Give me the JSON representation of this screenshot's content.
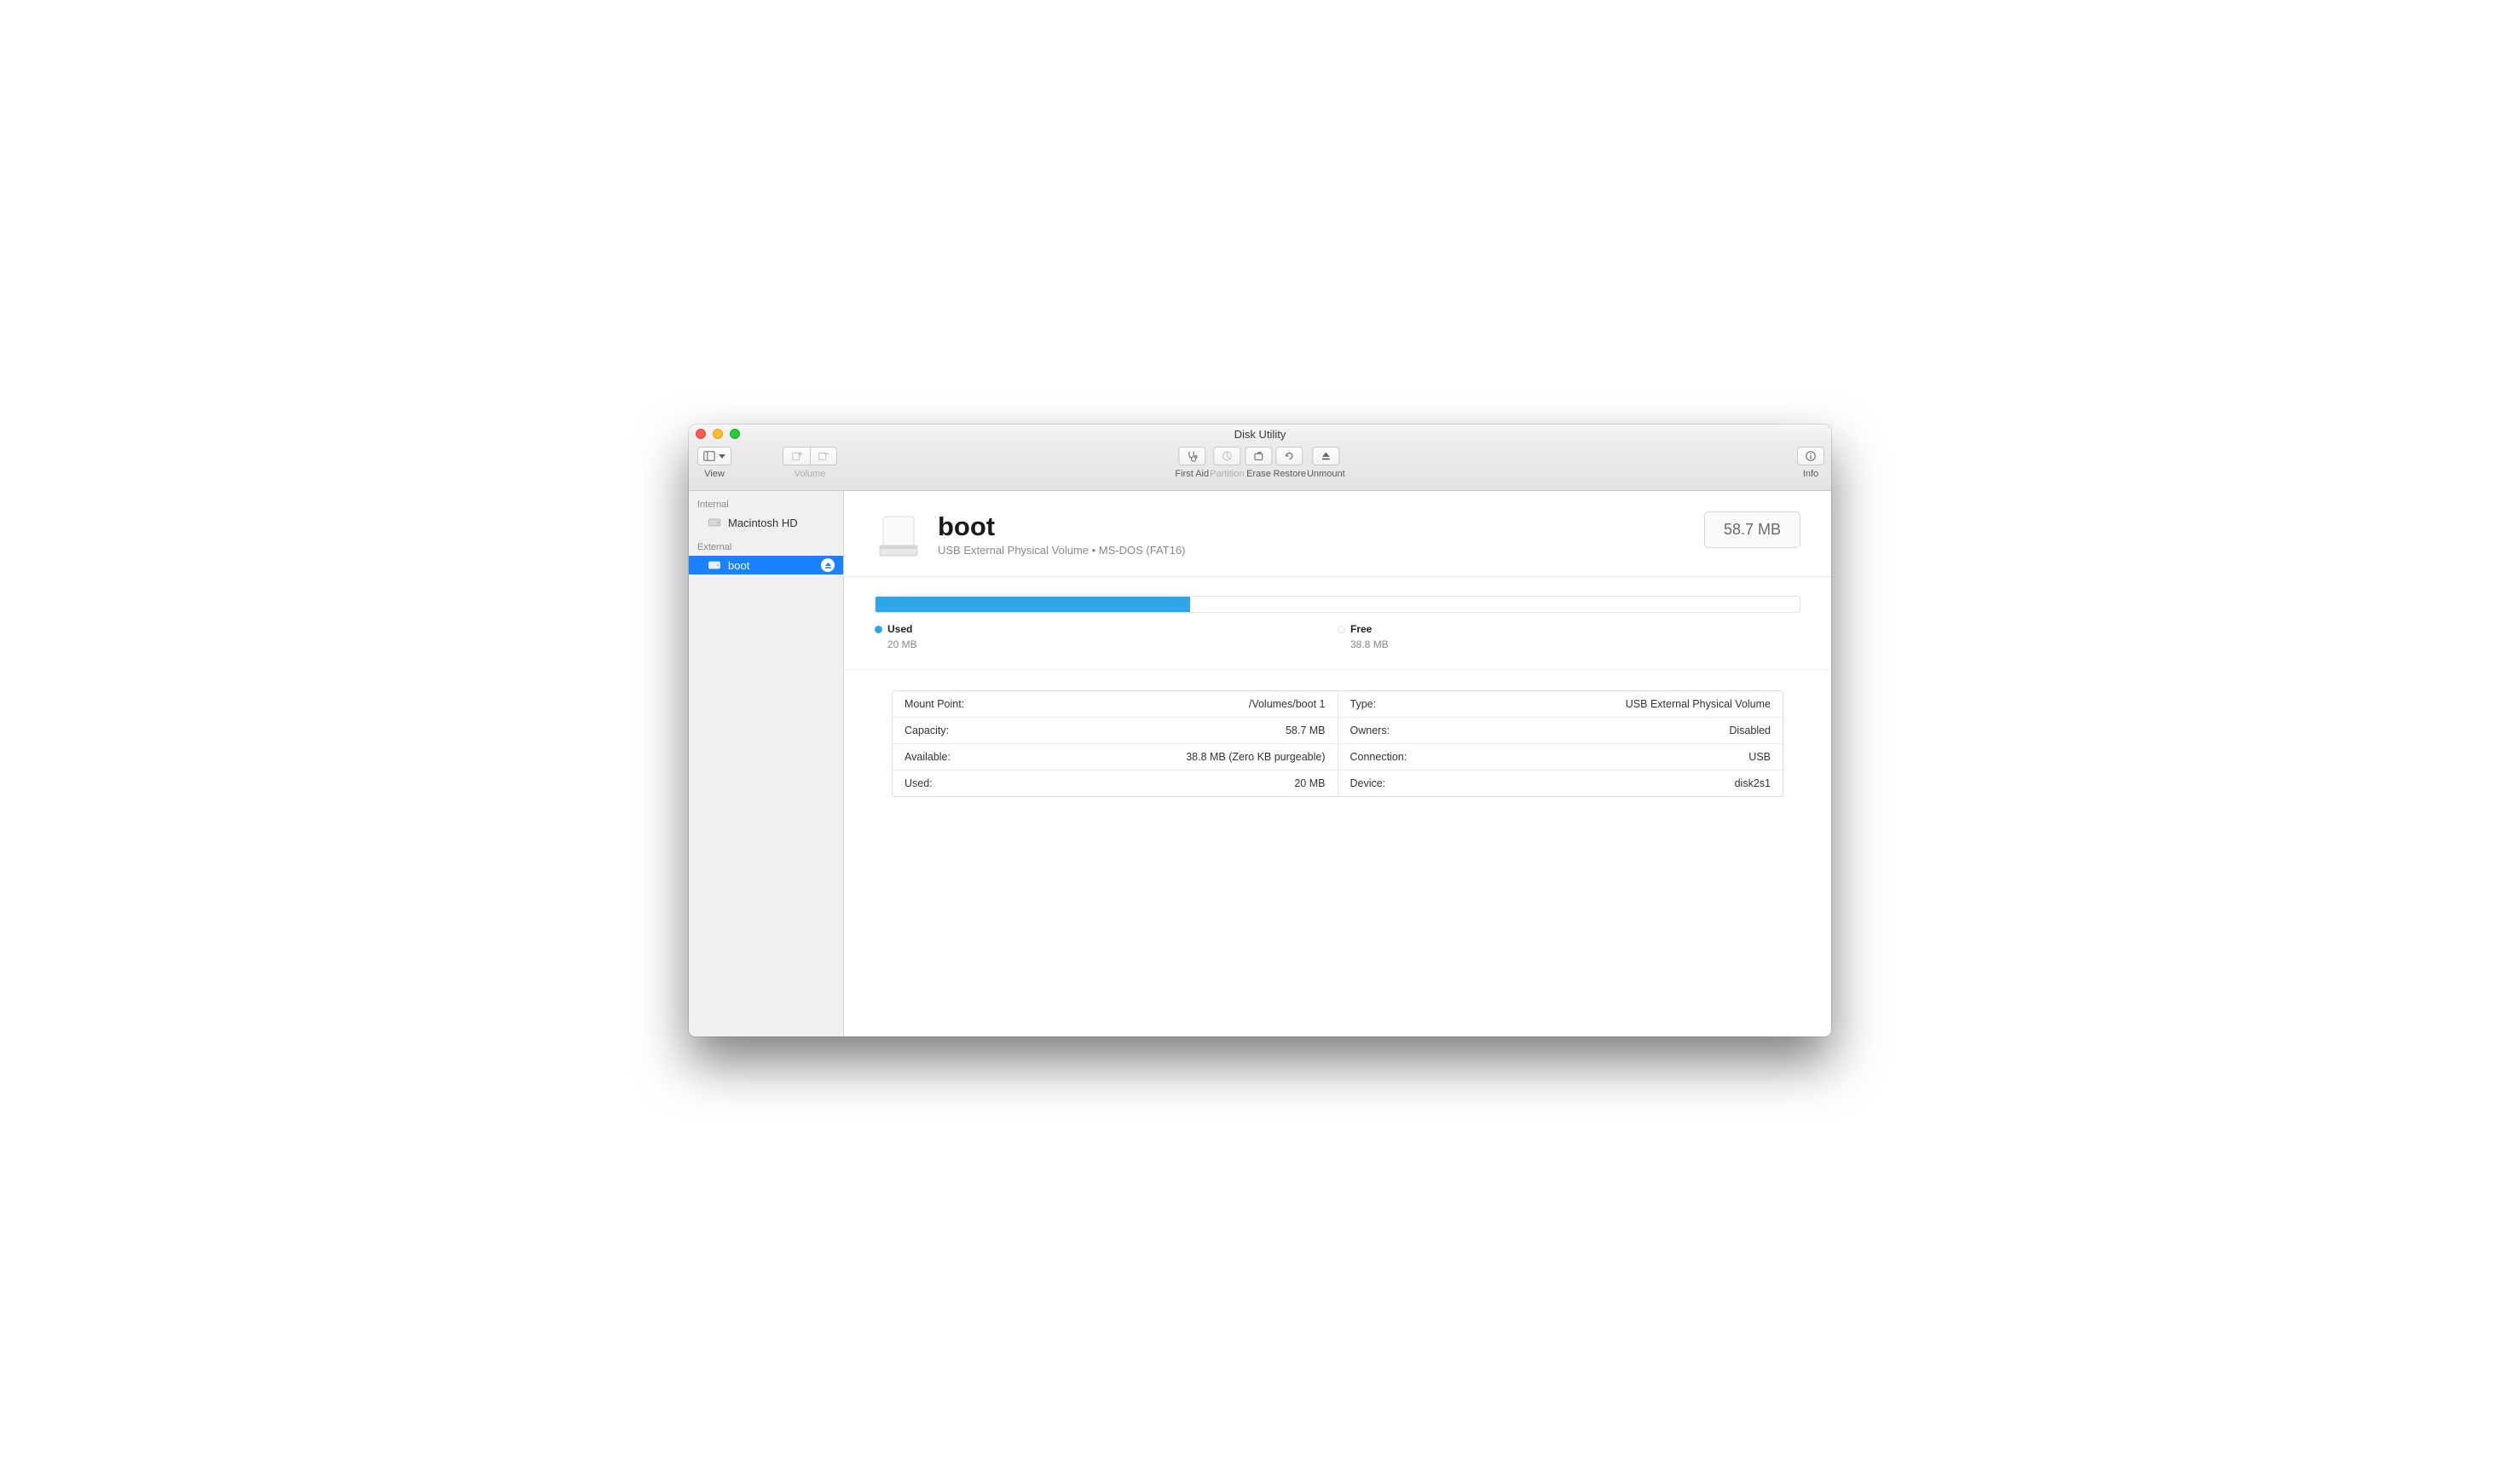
{
  "window": {
    "title": "Disk Utility"
  },
  "toolbar": {
    "view_label": "View",
    "volume_label": "Volume",
    "first_aid": "First Aid",
    "partition": "Partition",
    "erase": "Erase",
    "restore": "Restore",
    "unmount": "Unmount",
    "info": "Info"
  },
  "sidebar": {
    "internal_header": "Internal",
    "external_header": "External",
    "items": {
      "internal": [
        {
          "label": "Macintosh HD"
        }
      ],
      "external": [
        {
          "label": "boot"
        }
      ]
    }
  },
  "volume": {
    "name": "boot",
    "subtitle": "USB External Physical Volume • MS-DOS (FAT16)",
    "size_badge": "58.7 MB"
  },
  "usage": {
    "used_label": "Used",
    "used_value": "20 MB",
    "free_label": "Free",
    "free_value": "38.8 MB",
    "used_percent": 34
  },
  "details": {
    "left": [
      {
        "k": "Mount Point:",
        "v": "/Volumes/boot 1"
      },
      {
        "k": "Capacity:",
        "v": "58.7 MB"
      },
      {
        "k": "Available:",
        "v": "38.8 MB (Zero KB purgeable)"
      },
      {
        "k": "Used:",
        "v": "20 MB"
      }
    ],
    "right": [
      {
        "k": "Type:",
        "v": "USB External Physical Volume"
      },
      {
        "k": "Owners:",
        "v": "Disabled"
      },
      {
        "k": "Connection:",
        "v": "USB"
      },
      {
        "k": "Device:",
        "v": "disk2s1"
      }
    ]
  }
}
